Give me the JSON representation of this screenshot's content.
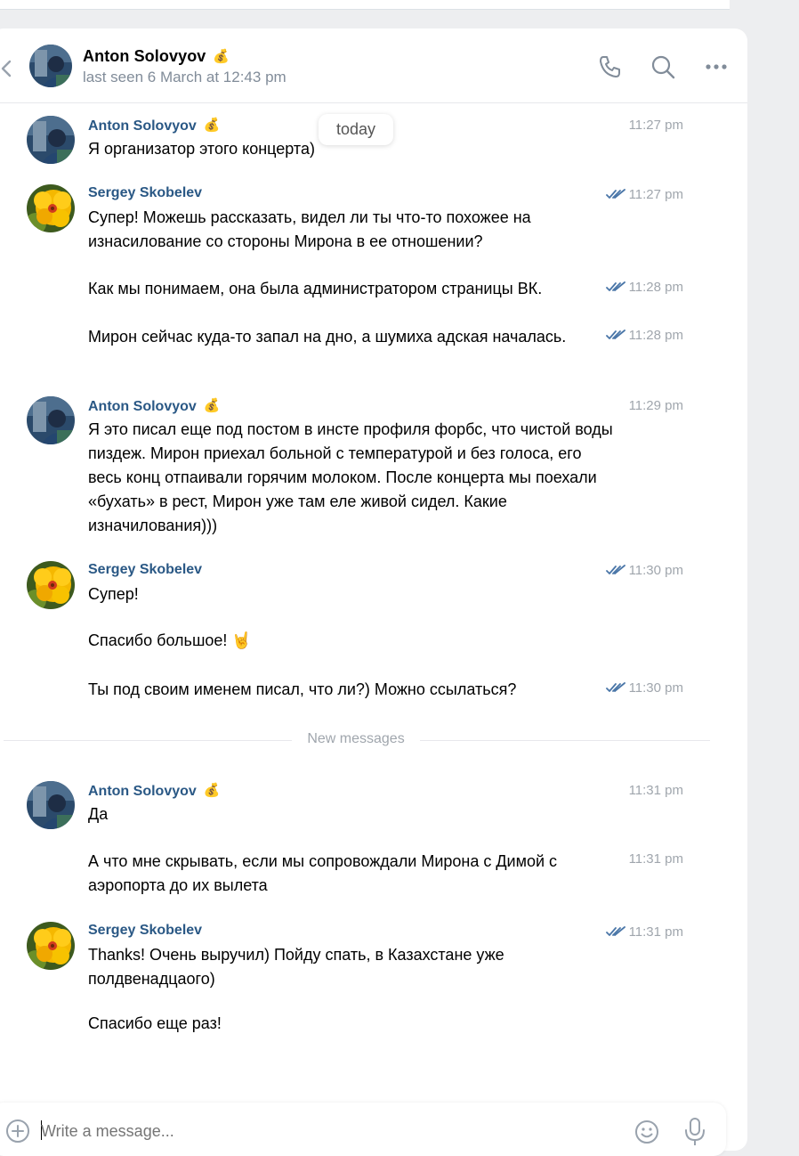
{
  "header": {
    "name": "Anton Solovyov",
    "status": "last seen 6 March at 12:43 pm",
    "badge": "💰",
    "call_icon": "phone-icon",
    "search_icon": "search-icon",
    "more_icon": "more-icon"
  },
  "today_label": "today",
  "divider_label": "New messages",
  "messages": [
    {
      "author": "Anton Solovyov",
      "badge": "💰",
      "avatar": "anton",
      "lines": [
        {
          "text": "Я организатор этого концерта)",
          "time": "11:27 pm",
          "read": false
        }
      ]
    },
    {
      "author": "Sergey Skobelev",
      "avatar": "sergey",
      "lines": [
        {
          "text": "Супер! Можешь рассказать, видел ли ты что-то похожее на изнасилование со стороны Мирона в ее отношении?",
          "time": "11:27 pm",
          "read": true
        },
        {
          "text": "Как мы понимаем, она была администратором страницы ВК.",
          "time": "11:28 pm",
          "read": true
        },
        {
          "text": "Мирон сейчас куда-то запал на дно, а шумиха адская началась.",
          "time": "11:28 pm",
          "read": true
        }
      ]
    },
    {
      "author": "Anton Solovyov",
      "badge": "💰",
      "avatar": "anton",
      "lines": [
        {
          "text": "Я это писал еще под постом в инсте профиля форбс, что чистой воды пиздеж. Мирон приехал больной с температурой и без голоса, его весь конц отпаивали горячим молоком. После концерта мы поехали «бухать» в рест, Мирон уже там еле живой сидел. Какие изначилования)))",
          "time": "11:29 pm",
          "read": false
        }
      ]
    },
    {
      "author": "Sergey Skobelev",
      "avatar": "sergey",
      "lines": [
        {
          "text": "Супер!",
          "time": "11:30 pm",
          "read": true
        },
        {
          "text": "Спасибо большое! 🤘",
          "time": "",
          "read": false
        },
        {
          "text": "Ты под своим именем писал, что ли?) Можно ссылаться?",
          "time": "11:30 pm",
          "read": true
        }
      ]
    },
    {
      "author": "Anton Solovyov",
      "badge": "💰",
      "avatar": "anton",
      "lines": [
        {
          "text": "Да",
          "time": "11:31 pm",
          "read": false
        },
        {
          "text": "А что мне скрывать, если мы сопровождали Мирона с Димой с аэропорта до их вылета",
          "time": "11:31 pm",
          "read": false
        }
      ]
    },
    {
      "author": "Sergey Skobelev",
      "avatar": "sergey",
      "lines": [
        {
          "text": "Thanks! Очень выручил) Пойду спать, в Казахстане уже полдвенадцаого)",
          "time": "11:31 pm",
          "read": true
        },
        {
          "text": "Спасибо еще раз!",
          "time": "",
          "read": false
        }
      ]
    }
  ],
  "composer": {
    "placeholder": "Write a message...",
    "attach_icon": "plus-circle-icon",
    "emoji_icon": "smile-icon",
    "mic_icon": "microphone-icon"
  },
  "colors": {
    "author": "#2a5885",
    "tick": "#4a76a8",
    "muted": "#818c99"
  }
}
